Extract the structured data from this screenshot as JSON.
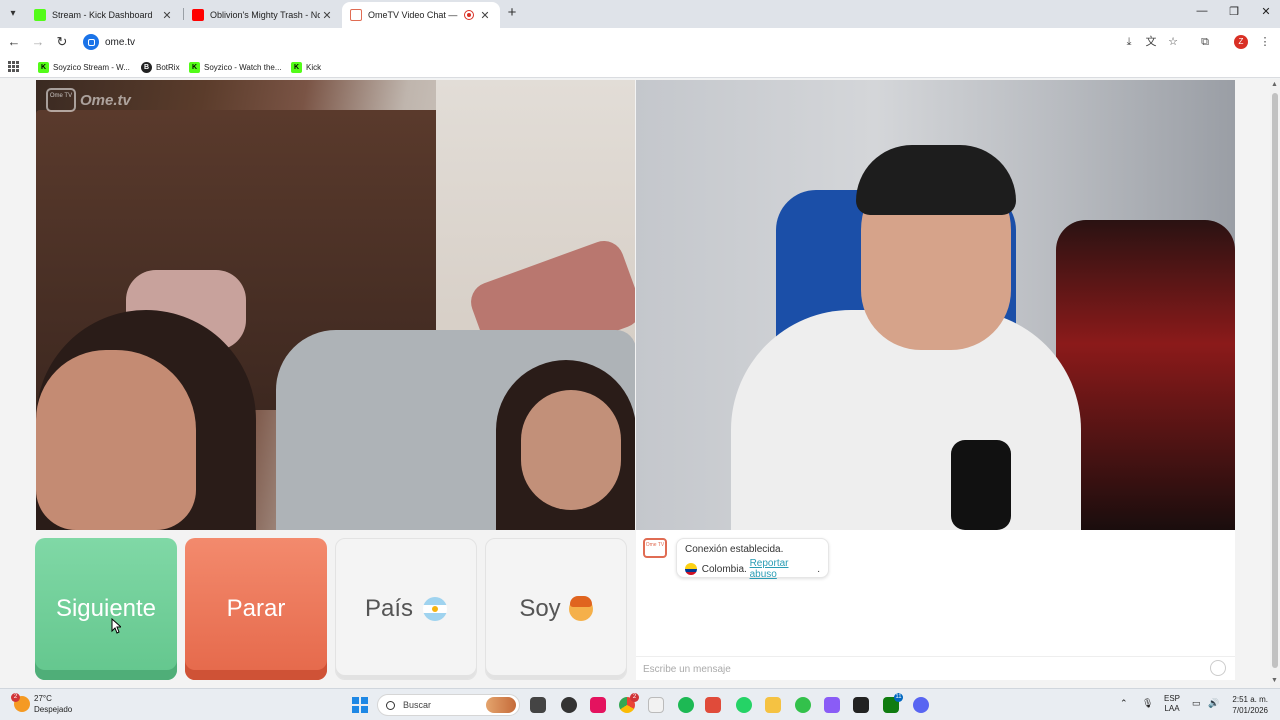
{
  "browser": {
    "tabs": [
      {
        "title": "Stream - Kick Dashboard",
        "favicon": "kick-icon",
        "active": false
      },
      {
        "title": "Oblivion's Mighty Trash - No M",
        "favicon": "youtube-icon",
        "active": false
      },
      {
        "title": "OmeTV Video Chat — Ome",
        "favicon": "ometv-icon",
        "active": true,
        "recording": true
      }
    ],
    "url": "ome.tv",
    "profile_initial": "Z",
    "bookmarks": [
      {
        "label": "Soyzico Stream - W...",
        "icon": "kick-icon"
      },
      {
        "label": "BotRix",
        "icon": "botrix-icon"
      },
      {
        "label": "Soyzico - Watch the...",
        "icon": "kick-icon"
      },
      {
        "label": "Kick",
        "icon": "kick-icon"
      }
    ]
  },
  "ometv": {
    "logo_text": "Ome.tv",
    "logo_badge": "Ome TV",
    "buttons": {
      "next": "Siguiente",
      "stop": "Parar",
      "country": "País",
      "gender": "Soy"
    },
    "chat": {
      "avatar": "Ome TV",
      "message_line1": "Conexión establecida.",
      "country": "Colombia.",
      "report_link": "Reportar abuso",
      "report_suffix": ".",
      "input_placeholder": "Escribe un mensaje"
    }
  },
  "taskbar": {
    "weather_temp": "27°C",
    "weather_desc": "Despejado",
    "weather_badge": "2",
    "search_label": "Buscar",
    "lang_top": "ESP",
    "lang_bottom": "LAA",
    "time": "2:51 a. m.",
    "date": "7/01/2026",
    "chrome_badge": "2",
    "xbox_badge": "11"
  },
  "colors": {
    "next": "#6ccf96",
    "stop": "#ea7456",
    "link": "#2a9db5"
  }
}
